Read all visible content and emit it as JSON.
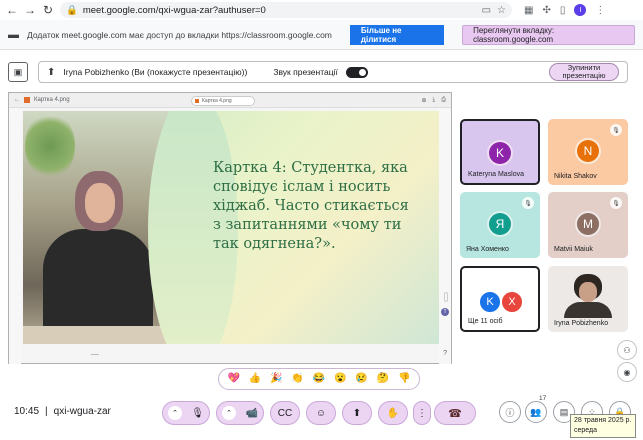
{
  "browser": {
    "url": "meet.google.com/qxi-wgua-zar?authuser=0",
    "profile_initial": "I"
  },
  "share_banner": {
    "text": "Додаток meet.google.com має доступ до вкладки https://classroom.google.com",
    "stop_label": "Більше не ділитися",
    "switch_label": "Переглянути вкладку: classroom.google.com"
  },
  "meet_bar": {
    "presenter": "Iryna Pobizhenko (Ви (покажусте презентацію))",
    "sound_label": "Звук презентації",
    "stop_present_label": "Зупинити презентацію"
  },
  "shared_screen": {
    "tab_title": "Картка 4.png",
    "center_tab": "Картка 4.png",
    "slide_text": "Картка 4: Студентка, яка сповідує іслам і носить хіджаб. Часто стикається з запитаннями «чому ти так одягнена?».",
    "help": "?"
  },
  "participants": [
    {
      "name": "Kateryna Maslova",
      "initial": "K",
      "color": "#8e24aa",
      "bg": "#d9c6ee",
      "muted": false
    },
    {
      "name": "Nikita Shakov",
      "initial": "N",
      "color": "#e8710a",
      "bg": "#fbc9a2",
      "muted": true
    },
    {
      "name": "Яна Хоменко",
      "initial": "Я",
      "color": "#129e8f",
      "bg": "#b6e6df",
      "muted": true
    },
    {
      "name": "Matvii Maiuk",
      "initial": "M",
      "color": "#8d6e63",
      "bg": "#e3cfc7",
      "muted": true
    },
    {
      "name": "Ще 11 осіб",
      "initials": [
        "K",
        "X"
      ],
      "colors": [
        "#1a73e8",
        "#e8453c"
      ],
      "bg": "#ffffff"
    },
    {
      "name": "Iryna Pobizhenko",
      "bg": "#ece9e7"
    }
  ],
  "reactions": [
    "💖",
    "👍",
    "🎉",
    "👏",
    "😂",
    "😮",
    "😢",
    "🤔",
    "👎"
  ],
  "bottom_bar": {
    "time": "10:45",
    "meeting_code": "qxi-wgua-zar",
    "people_count": "17",
    "date_tooltip_line1": "28 травня 2025 р.",
    "date_tooltip_line2": "середа"
  },
  "colors": {
    "accent_blue": "#1a73e8",
    "control_pill": "#ecd4f3",
    "slide_text": "#2e6e45"
  },
  "icons": [
    "back-icon",
    "forward-icon",
    "reload-icon",
    "lock-icon",
    "cast-icon",
    "star-icon",
    "puzzle-icon",
    "mic-icon",
    "camera-icon",
    "captions-icon",
    "emoji-icon",
    "present-icon",
    "hand-icon",
    "more-icon",
    "end-call-icon",
    "info-icon",
    "people-icon",
    "chat-icon",
    "activities-icon",
    "host-controls-icon"
  ]
}
